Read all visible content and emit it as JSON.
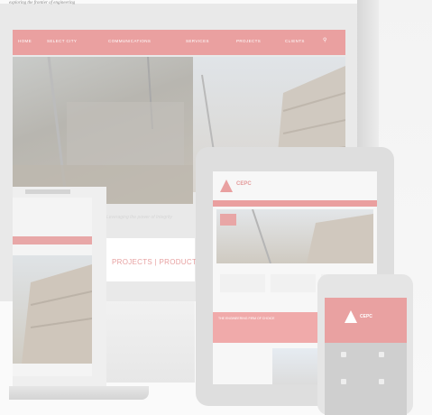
{
  "tagline": "exploring the frontier of engineering",
  "website": {
    "nav_items": [
      "HOME",
      "SELECT CITY",
      "COMMUNICATIONS",
      "SERVICES",
      "PROJECTS",
      "CLIENTS"
    ],
    "hero_caption": "Leveraging the power of Integrity",
    "strip_text": "PROJECTS | PRODUCTS"
  },
  "tablet": {
    "logo_text": "CEPC",
    "band_text": "THE ENGINEERING FIRM OF CHOICE"
  },
  "phone": {
    "logo_text": "CEPC"
  },
  "colors": {
    "brand": "#e9a0a0",
    "background": "#fafafa"
  }
}
